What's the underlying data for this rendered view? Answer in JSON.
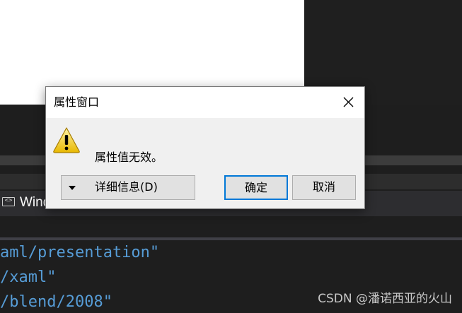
{
  "background": {
    "tab_label": "Wind",
    "code_lines": [
      "aml/presentation\"",
      "/xaml\"",
      "/blend/2008\""
    ],
    "watermark": "CSDN @潘诺西亚的火山"
  },
  "dialog": {
    "title": "属性窗口",
    "message": "属性值无效。",
    "icon": "warning-icon",
    "buttons": {
      "details": "详细信息(D)",
      "ok": "确定",
      "cancel": "取消"
    }
  },
  "colors": {
    "accent": "#0078d7",
    "code_text": "#569cd6",
    "dialog_bg": "#f0f0f0"
  }
}
